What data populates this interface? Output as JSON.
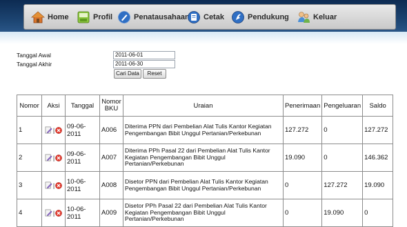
{
  "menu": {
    "items": [
      {
        "label": "Home",
        "icon": "home-icon"
      },
      {
        "label": "Profil",
        "icon": "profile-icon"
      },
      {
        "label": "Penatausahaan",
        "icon": "administration-icon"
      },
      {
        "label": "Cetak",
        "icon": "print-icon"
      },
      {
        "label": "Pendukung",
        "icon": "support-icon"
      },
      {
        "label": "Keluar",
        "icon": "logout-icon"
      }
    ]
  },
  "filter": {
    "start_label": "Tanggal Awal",
    "start_value": "2011-06-01",
    "end_label": "Tanggal Akhir",
    "end_value": "2011-06-30",
    "search_button": "Cari Data",
    "reset_button": "Reset"
  },
  "table": {
    "headers": [
      "Nomor",
      "Aksi",
      "Tanggal",
      "Nomor BKU",
      "Uraian",
      "Penerimaan",
      "Pengeluaran",
      "Saldo"
    ],
    "action_separator": "|",
    "rows": [
      {
        "nomor": "1",
        "tanggal": "09-06-2011",
        "bku": "A006",
        "uraian": "Diterima PPN dari Pembelian Alat Tulis Kantor Kegiatan Pengembangan Bibit Unggul Pertanian/Perkebunan",
        "penerimaan": "127.272",
        "pengeluaran": "0",
        "saldo": "127.272"
      },
      {
        "nomor": "2",
        "tanggal": "09-06-2011",
        "bku": "A007",
        "uraian": "Diterima PPh Pasal 22 dari Pembelian Alat Tulis Kantor Kegiatan Pengembangan Bibit Unggul Pertanian/Perkebunan",
        "penerimaan": "19.090",
        "pengeluaran": "0",
        "saldo": "146.362"
      },
      {
        "nomor": "3",
        "tanggal": "10-06-2011",
        "bku": "A008",
        "uraian": "Disetor PPN dari Pembelian Alat Tulis Kantor Kegiatan Pengembangan Bibit Unggul Pertanian/Perkebunan",
        "penerimaan": "0",
        "pengeluaran": "127.272",
        "saldo": "19.090"
      },
      {
        "nomor": "4",
        "tanggal": "10-06-2011",
        "bku": "A009",
        "uraian": "Disetor PPh Pasal 22 dari Pembelian Alat Tulis Kantor Kegiatan Pengembangan Bibit Unggul Pertanian/Perkebunan",
        "penerimaan": "0",
        "pengeluaran": "19.090",
        "saldo": "0"
      }
    ]
  },
  "colors": {
    "header_band": "#1e4775",
    "menu_background": "#d6d6d6",
    "border": "#8c8c8c"
  }
}
